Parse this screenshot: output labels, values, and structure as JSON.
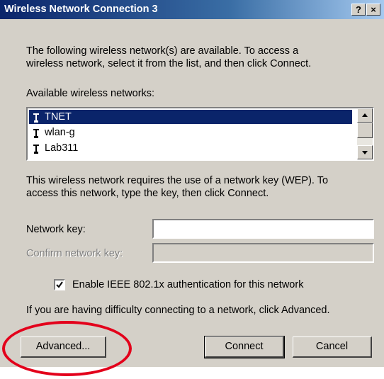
{
  "window": {
    "title": "Wireless Network Connection 3",
    "help_button": "?",
    "close_button": "×"
  },
  "intro_text": {
    "line1": "The following wireless network(s) are available. To access a",
    "line2": "wireless network, select it from the list, and then click Connect."
  },
  "networks_label": "Available wireless networks:",
  "networks": [
    {
      "name": "TNET",
      "selected": true
    },
    {
      "name": "wlan-g",
      "selected": false
    },
    {
      "name": "Lab311",
      "selected": false
    }
  ],
  "wep_text": {
    "line1": "This wireless network requires the use of a network key (WEP). To",
    "line2": "access this network, type the key, then click Connect."
  },
  "network_key": {
    "label": "Network key:",
    "value": ""
  },
  "confirm_key": {
    "label": "Confirm network key:",
    "value": ""
  },
  "ieee_checkbox": {
    "label": "Enable IEEE 802.1x authentication for this network",
    "checked": true
  },
  "advanced_hint": "If you are having difficulty connecting to a network, click Advanced.",
  "buttons": {
    "advanced": "Advanced...",
    "connect": "Connect",
    "cancel": "Cancel"
  },
  "colors": {
    "annotation_ring": "#e3001b",
    "selection": "#0a246a",
    "dialog_face": "#d4d0c8"
  }
}
